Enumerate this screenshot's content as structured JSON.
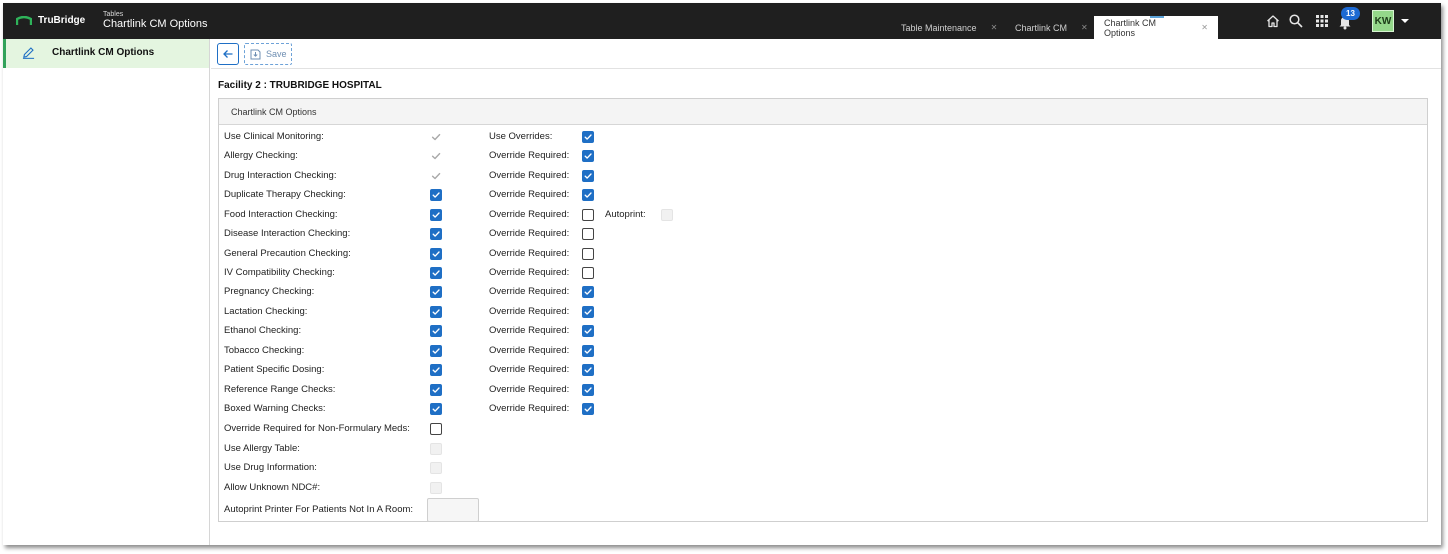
{
  "app": {
    "brand": "TruBridge",
    "breadcrumb_small": "Tables",
    "breadcrumb_title": "Chartlink CM Options"
  },
  "tabs": [
    {
      "label": "Table Maintenance",
      "active": false
    },
    {
      "label": "Chartlink CM",
      "active": false
    },
    {
      "label": "Chartlink CM Options",
      "active": true
    }
  ],
  "header": {
    "notification_count": "13",
    "user_initials": "KW",
    "icons": [
      "home-icon",
      "search-icon",
      "apps-grid-icon",
      "bell-icon",
      "chevron-down-icon"
    ]
  },
  "sidebar": {
    "items": [
      {
        "label": "Chartlink CM Options",
        "icon": "pencil-icon",
        "active": true
      }
    ]
  },
  "toolbar": {
    "save_label": "Save"
  },
  "facility": "Facility 2 : TRUBRIDGE HOSPITAL",
  "panel": {
    "title": "Chartlink CM Options"
  },
  "options": [
    {
      "label": "Use Clinical Monitoring:",
      "state": "disabled-checked",
      "sub_label": "Use Overrides:",
      "sub_state": "checked"
    },
    {
      "label": "Allergy Checking:",
      "state": "disabled-checked",
      "sub_label": "Override Required:",
      "sub_state": "checked"
    },
    {
      "label": "Drug Interaction Checking:",
      "state": "disabled-checked",
      "sub_label": "Override Required:",
      "sub_state": "checked"
    },
    {
      "label": "Duplicate Therapy Checking:",
      "state": "checked",
      "sub_label": "Override Required:",
      "sub_state": "checked"
    },
    {
      "label": "Food Interaction Checking:",
      "state": "checked",
      "sub_label": "Override Required:",
      "sub_state": "unchecked",
      "extra_label": "Autoprint:",
      "extra_state": "disabled-unchecked"
    },
    {
      "label": "Disease Interaction Checking:",
      "state": "checked",
      "sub_label": "Override Required:",
      "sub_state": "unchecked"
    },
    {
      "label": "General Precaution Checking:",
      "state": "checked",
      "sub_label": "Override Required:",
      "sub_state": "unchecked"
    },
    {
      "label": "IV Compatibility Checking:",
      "state": "checked",
      "sub_label": "Override Required:",
      "sub_state": "unchecked"
    },
    {
      "label": "Pregnancy Checking:",
      "state": "checked",
      "sub_label": "Override Required:",
      "sub_state": "checked"
    },
    {
      "label": "Lactation Checking:",
      "state": "checked",
      "sub_label": "Override Required:",
      "sub_state": "checked"
    },
    {
      "label": "Ethanol Checking:",
      "state": "checked",
      "sub_label": "Override Required:",
      "sub_state": "checked"
    },
    {
      "label": "Tobacco Checking:",
      "state": "checked",
      "sub_label": "Override Required:",
      "sub_state": "checked"
    },
    {
      "label": "Patient Specific Dosing:",
      "state": "checked",
      "sub_label": "Override Required:",
      "sub_state": "checked"
    },
    {
      "label": "Reference Range Checks:",
      "state": "checked",
      "sub_label": "Override Required:",
      "sub_state": "checked"
    },
    {
      "label": "Boxed Warning Checks:",
      "state": "checked",
      "sub_label": "Override Required:",
      "sub_state": "checked"
    }
  ],
  "extra_options": [
    {
      "label": "Override Required for Non-Formulary Meds:",
      "state": "unchecked"
    },
    {
      "label": "Use Allergy Table:",
      "state": "disabled-unchecked"
    },
    {
      "label": "Use Drug Information:",
      "state": "disabled-unchecked"
    },
    {
      "label": "Allow Unknown NDC#:",
      "state": "disabled-unchecked"
    }
  ],
  "printer": {
    "label": "Autoprint Printer For Patients Not In A Room:",
    "value": ""
  },
  "colors": {
    "accent": "#1f6fc5",
    "topbar": "#1f1f1f",
    "sidebar_active": "#e4f5e0",
    "sidebar_active_border": "#32a25a",
    "avatar": "#94d88a",
    "badge": "#1d6ad3"
  }
}
